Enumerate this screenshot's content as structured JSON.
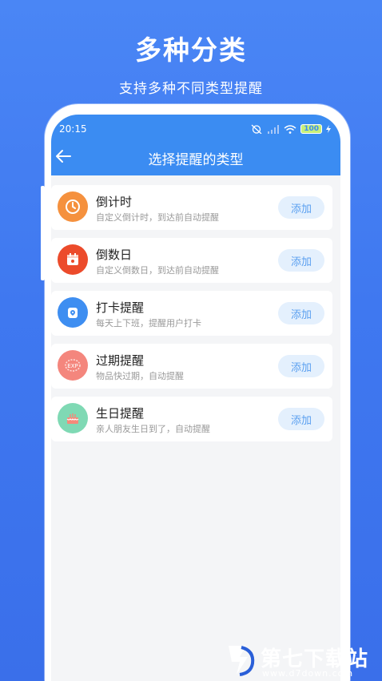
{
  "promo": {
    "headline": "多种分类",
    "subline": "支持多种不同类型提醒"
  },
  "status_bar": {
    "time": "20:15",
    "battery": "100"
  },
  "appbar": {
    "title": "选择提醒的类型",
    "back_icon": "arrow-left-icon"
  },
  "reminder_types": [
    {
      "title": "倒计时",
      "desc": "自定义倒计时，到达前自动提醒",
      "button": "添加",
      "icon": "clock-icon",
      "color": "#f5913e"
    },
    {
      "title": "倒数日",
      "desc": "自定义倒数日，到达前自动提醒",
      "button": "添加",
      "icon": "calendar-icon",
      "color": "#ec4b2b"
    },
    {
      "title": "打卡提醒",
      "desc": "每天上下班，提醒用户打卡",
      "button": "添加",
      "icon": "location-pin-icon",
      "color": "#3e8ef1"
    },
    {
      "title": "过期提醒",
      "desc": "物品快过期，自动提醒",
      "button": "添加",
      "icon": "expiry-icon",
      "color": "#f4867d"
    },
    {
      "title": "生日提醒",
      "desc": "亲人朋友生日到了，自动提醒",
      "button": "添加",
      "icon": "cake-icon",
      "color": "#7fd9b4"
    }
  ],
  "watermark": {
    "text": "第七下载站",
    "url": "www.d7down.com"
  }
}
